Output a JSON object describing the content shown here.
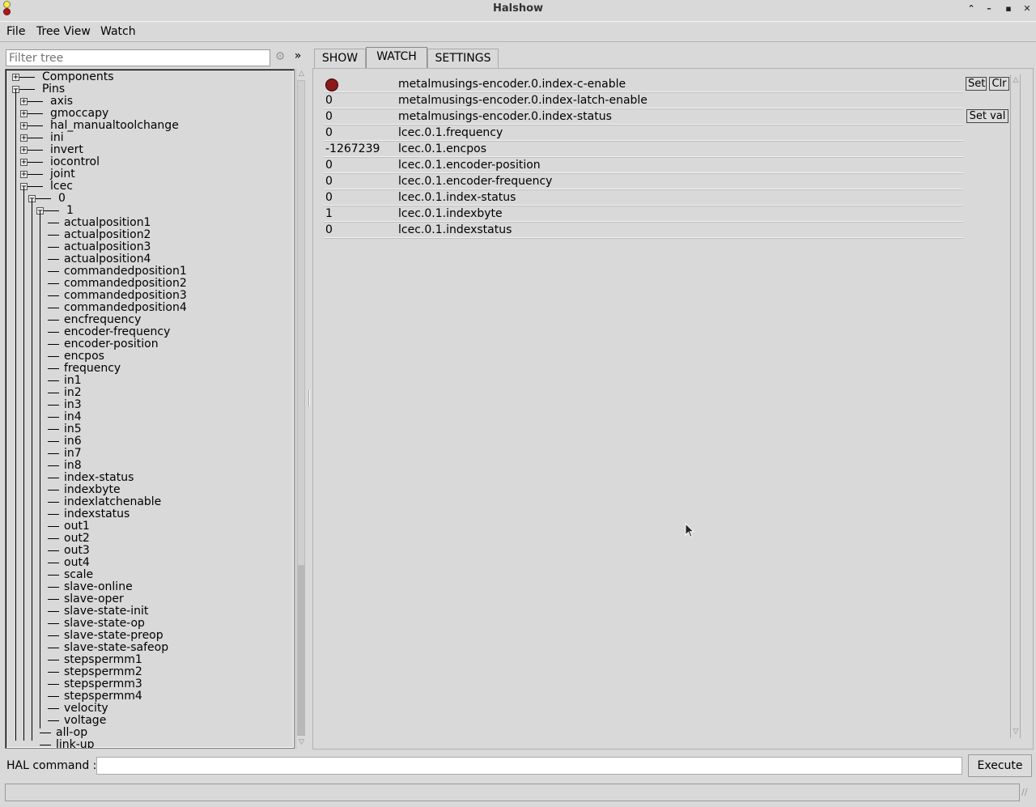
{
  "window": {
    "title": "Halshow",
    "controls": [
      "minimize-up",
      "minimize",
      "maximize",
      "close"
    ]
  },
  "menubar": {
    "items": [
      "File",
      "Tree View",
      "Watch"
    ]
  },
  "filter": {
    "placeholder": "Filter tree",
    "expand_symbol": "»"
  },
  "tree": {
    "rows": [
      {
        "label": "Components",
        "depth": 0,
        "expanded": false
      },
      {
        "label": "Pins",
        "depth": 0,
        "expanded": true
      },
      {
        "label": "axis",
        "depth": 1,
        "expanded": false
      },
      {
        "label": "gmoccapy",
        "depth": 1,
        "expanded": false
      },
      {
        "label": "hal_manualtoolchange",
        "depth": 1,
        "expanded": false
      },
      {
        "label": "ini",
        "depth": 1,
        "expanded": false
      },
      {
        "label": "invert",
        "depth": 1,
        "expanded": false
      },
      {
        "label": "iocontrol",
        "depth": 1,
        "expanded": false
      },
      {
        "label": "joint",
        "depth": 1,
        "expanded": false
      },
      {
        "label": "lcec",
        "depth": 1,
        "expanded": true
      },
      {
        "label": "0",
        "depth": 2,
        "expanded": true
      },
      {
        "label": "1",
        "depth": 3,
        "expanded": true
      },
      {
        "label": "actualposition1",
        "depth": 4,
        "leaf": true
      },
      {
        "label": "actualposition2",
        "depth": 4,
        "leaf": true
      },
      {
        "label": "actualposition3",
        "depth": 4,
        "leaf": true
      },
      {
        "label": "actualposition4",
        "depth": 4,
        "leaf": true
      },
      {
        "label": "commandedposition1",
        "depth": 4,
        "leaf": true
      },
      {
        "label": "commandedposition2",
        "depth": 4,
        "leaf": true
      },
      {
        "label": "commandedposition3",
        "depth": 4,
        "leaf": true
      },
      {
        "label": "commandedposition4",
        "depth": 4,
        "leaf": true
      },
      {
        "label": "encfrequency",
        "depth": 4,
        "leaf": true
      },
      {
        "label": "encoder-frequency",
        "depth": 4,
        "leaf": true
      },
      {
        "label": "encoder-position",
        "depth": 4,
        "leaf": true
      },
      {
        "label": "encpos",
        "depth": 4,
        "leaf": true
      },
      {
        "label": "frequency",
        "depth": 4,
        "leaf": true
      },
      {
        "label": "in1",
        "depth": 4,
        "leaf": true
      },
      {
        "label": "in2",
        "depth": 4,
        "leaf": true
      },
      {
        "label": "in3",
        "depth": 4,
        "leaf": true
      },
      {
        "label": "in4",
        "depth": 4,
        "leaf": true
      },
      {
        "label": "in5",
        "depth": 4,
        "leaf": true
      },
      {
        "label": "in6",
        "depth": 4,
        "leaf": true
      },
      {
        "label": "in7",
        "depth": 4,
        "leaf": true
      },
      {
        "label": "in8",
        "depth": 4,
        "leaf": true
      },
      {
        "label": "index-status",
        "depth": 4,
        "leaf": true
      },
      {
        "label": "indexbyte",
        "depth": 4,
        "leaf": true
      },
      {
        "label": "indexlatchenable",
        "depth": 4,
        "leaf": true
      },
      {
        "label": "indexstatus",
        "depth": 4,
        "leaf": true
      },
      {
        "label": "out1",
        "depth": 4,
        "leaf": true
      },
      {
        "label": "out2",
        "depth": 4,
        "leaf": true
      },
      {
        "label": "out3",
        "depth": 4,
        "leaf": true
      },
      {
        "label": "out4",
        "depth": 4,
        "leaf": true
      },
      {
        "label": "scale",
        "depth": 4,
        "leaf": true
      },
      {
        "label": "slave-online",
        "depth": 4,
        "leaf": true
      },
      {
        "label": "slave-oper",
        "depth": 4,
        "leaf": true
      },
      {
        "label": "slave-state-init",
        "depth": 4,
        "leaf": true
      },
      {
        "label": "slave-state-op",
        "depth": 4,
        "leaf": true
      },
      {
        "label": "slave-state-preop",
        "depth": 4,
        "leaf": true
      },
      {
        "label": "slave-state-safeop",
        "depth": 4,
        "leaf": true
      },
      {
        "label": "stepspermm1",
        "depth": 4,
        "leaf": true
      },
      {
        "label": "stepspermm2",
        "depth": 4,
        "leaf": true
      },
      {
        "label": "stepspermm3",
        "depth": 4,
        "leaf": true
      },
      {
        "label": "stepspermm4",
        "depth": 4,
        "leaf": true
      },
      {
        "label": "velocity",
        "depth": 4,
        "leaf": true
      },
      {
        "label": "voltage",
        "depth": 4,
        "leaf": true
      },
      {
        "label": "all-op",
        "depth": 3,
        "leaf": true
      },
      {
        "label": "link-up",
        "depth": 3,
        "leaf": true
      }
    ]
  },
  "tabs": [
    {
      "label": "SHOW",
      "active": false
    },
    {
      "label": "WATCH",
      "active": true
    },
    {
      "label": "SETTINGS",
      "active": false
    }
  ],
  "watch": {
    "rows": [
      {
        "value": "",
        "led": true,
        "led_color": "#8b1a1a",
        "name": "metalmusings-encoder.0.index-c-enable"
      },
      {
        "value": "0",
        "name": "metalmusings-encoder.0.index-latch-enable"
      },
      {
        "value": "0",
        "name": "metalmusings-encoder.0.index-status"
      },
      {
        "value": "0",
        "name": "lcec.0.1.frequency"
      },
      {
        "value": "-1267239",
        "name": "lcec.0.1.encpos"
      },
      {
        "value": "0",
        "name": "lcec.0.1.encoder-position"
      },
      {
        "value": "0",
        "name": "lcec.0.1.encoder-frequency"
      },
      {
        "value": "0",
        "name": "lcec.0.1.index-status"
      },
      {
        "value": "1",
        "name": "lcec.0.1.indexbyte"
      },
      {
        "value": "0",
        "name": "lcec.0.1.indexstatus"
      }
    ],
    "set_label": "Set",
    "clr_label": "Clr",
    "setval_label": "Set val"
  },
  "command": {
    "label": "HAL command :",
    "value": "",
    "execute_label": "Execute"
  },
  "status": {
    "text": ""
  }
}
